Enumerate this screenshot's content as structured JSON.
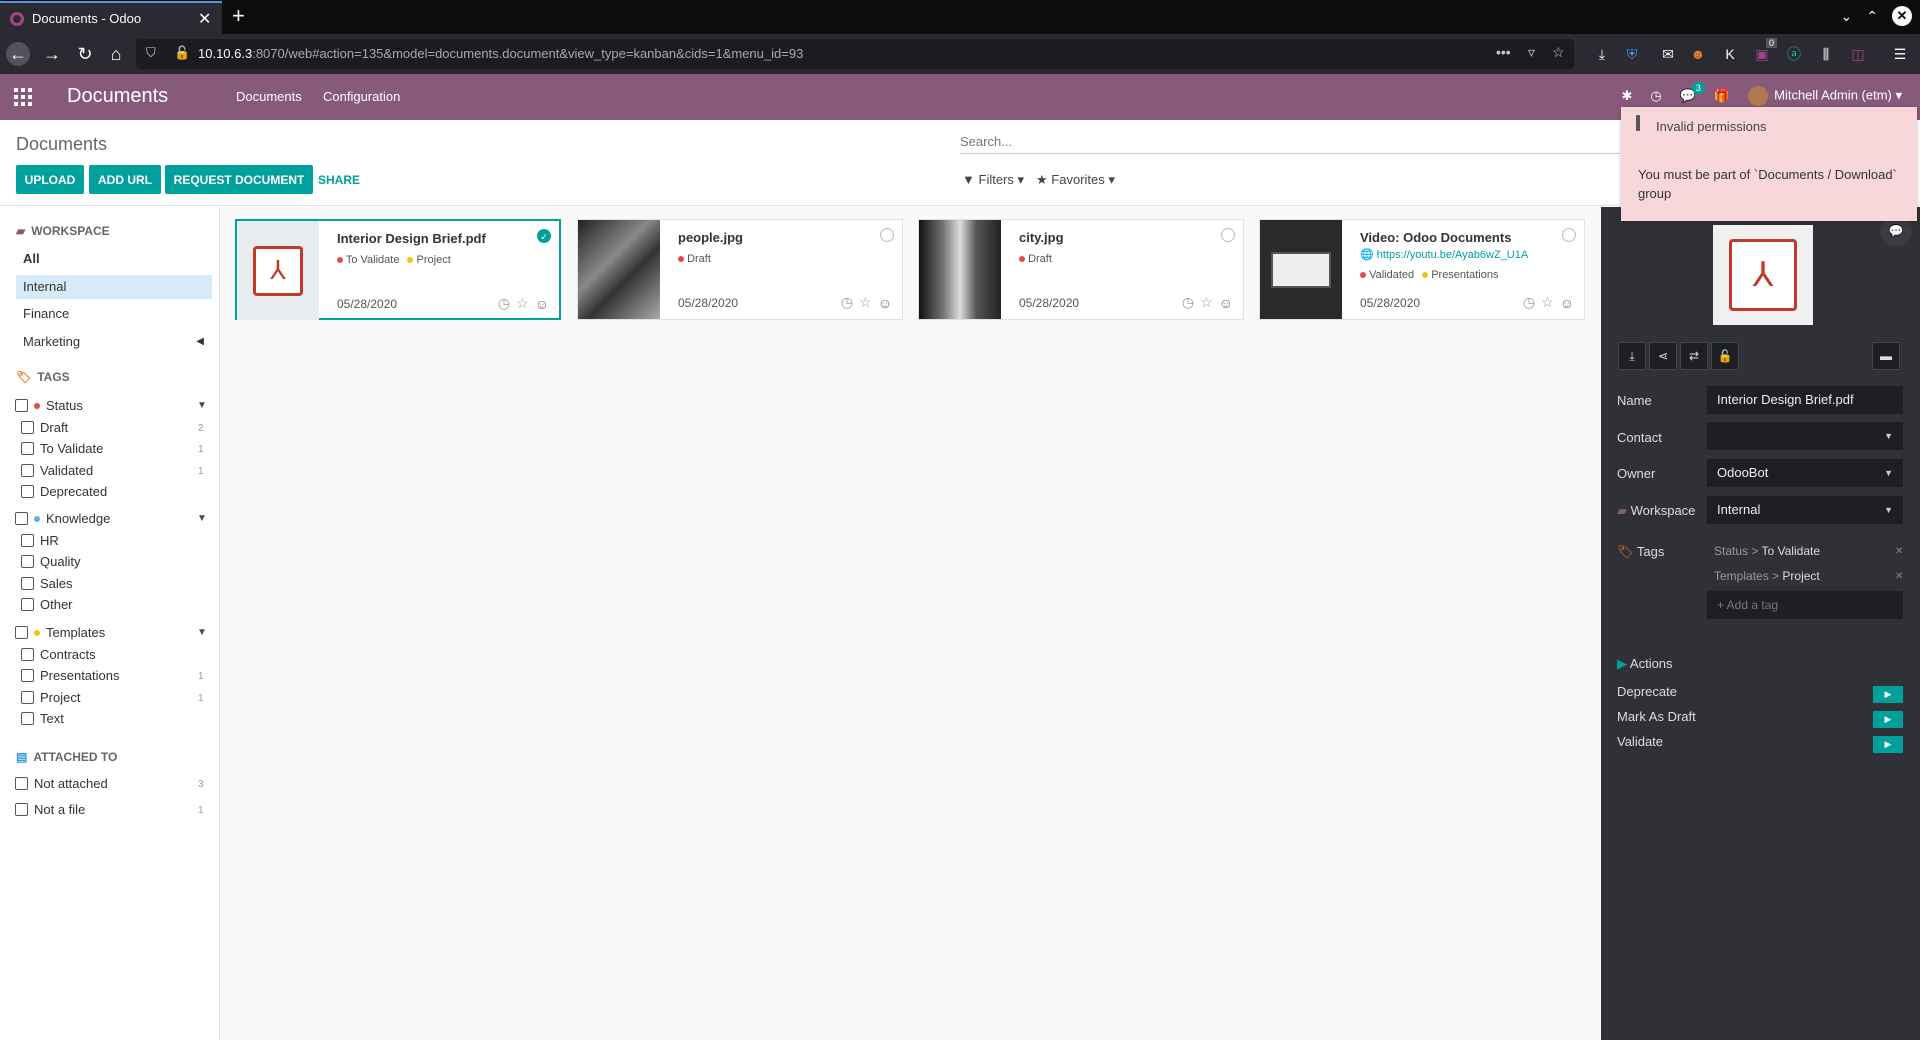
{
  "browser": {
    "tab_title": "Documents - Odoo",
    "new_tab": "+",
    "url_host": "10.10.6.3",
    "url_rest": ":8070/web#action=135&model=documents.document&view_type=kanban&cids=1&menu_id=93",
    "ext_badge": "0"
  },
  "odoo": {
    "app_title": "Documents",
    "menu": [
      "Documents",
      "Configuration"
    ],
    "chat_count": "3",
    "user": "Mitchell Admin (etm)"
  },
  "control_panel": {
    "breadcrumb": "Documents",
    "search_placeholder": "Search...",
    "buttons": {
      "upload": "UPLOAD",
      "add_url": "ADD URL",
      "request": "REQUEST DOCUMENT",
      "share": "SHARE"
    },
    "filters": "Filters",
    "favorites": "Favorites"
  },
  "sidebar": {
    "workspace_header": "WORKSPACE",
    "workspaces": [
      "All",
      "Internal",
      "Finance",
      "Marketing"
    ],
    "tags_header": "TAGS",
    "tag_groups": [
      {
        "name": "Status",
        "color": "#e74c3c",
        "tags": [
          {
            "name": "Draft",
            "count": "2"
          },
          {
            "name": "To Validate",
            "count": "1"
          },
          {
            "name": "Validated",
            "count": "1"
          },
          {
            "name": "Deprecated",
            "count": ""
          }
        ]
      },
      {
        "name": "Knowledge",
        "color": "#5dade2",
        "tags": [
          {
            "name": "HR",
            "count": ""
          },
          {
            "name": "Quality",
            "count": ""
          },
          {
            "name": "Sales",
            "count": ""
          },
          {
            "name": "Other",
            "count": ""
          }
        ]
      },
      {
        "name": "Templates",
        "color": "#f1c40f",
        "tags": [
          {
            "name": "Contracts",
            "count": ""
          },
          {
            "name": "Presentations",
            "count": "1"
          },
          {
            "name": "Project",
            "count": "1"
          },
          {
            "name": "Text",
            "count": ""
          }
        ]
      }
    ],
    "attached_header": "ATTACHED TO",
    "attached": [
      {
        "name": "Not attached",
        "count": "3"
      },
      {
        "name": "Not a file",
        "count": "1"
      }
    ]
  },
  "documents": [
    {
      "name": "Interior Design Brief.pdf",
      "tags": [
        "To Validate",
        "Project"
      ],
      "url": "",
      "date": "05/28/2020"
    },
    {
      "name": "people.jpg",
      "tags": [
        "Draft"
      ],
      "url": "",
      "date": "05/28/2020"
    },
    {
      "name": "city.jpg",
      "tags": [
        "Draft"
      ],
      "url": "",
      "date": "05/28/2020"
    },
    {
      "name": "Video: Odoo Documents",
      "tags": [
        "Validated",
        "Presentations"
      ],
      "url": "https://youtu.be/Ayab6wZ_U1A",
      "date": "05/28/2020"
    }
  ],
  "inspector": {
    "fields": {
      "name_label": "Name",
      "name_value": "Interior Design Brief.pdf",
      "contact_label": "Contact",
      "contact_value": "",
      "owner_label": "Owner",
      "owner_value": "OdooBot",
      "workspace_label": "Workspace",
      "workspace_value": "Internal",
      "tags_label": "Tags"
    },
    "tags": [
      {
        "category": "Status",
        "sep": ">",
        "value": "To Validate"
      },
      {
        "category": "Templates",
        "sep": ">",
        "value": "Project"
      }
    ],
    "add_tag_placeholder": "+ Add a tag",
    "actions_label": "Actions",
    "actions": [
      "Deprecate",
      "Mark As Draft",
      "Validate"
    ]
  },
  "notification": {
    "title": "Invalid permissions",
    "body": "You must be part of `Documents / Download` group"
  },
  "colors": {
    "odoo_purple": "#875a7b",
    "teal": "#00a09d",
    "inspector_bg": "#2f3136",
    "notif_bg": "#f8d7da"
  }
}
